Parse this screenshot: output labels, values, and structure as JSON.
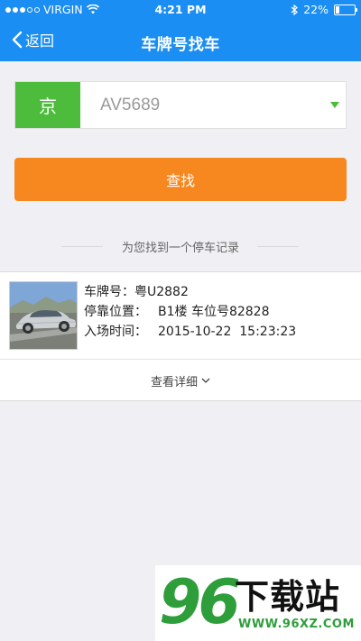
{
  "status_bar": {
    "carrier": "VIRGIN",
    "time": "4:21 PM",
    "battery": "22%",
    "signal_bars_full": 3,
    "signal_bars_total": 5
  },
  "nav": {
    "back_label": "返回",
    "title": "车牌号找车"
  },
  "plate_search": {
    "province": "京",
    "plate_value": "AV5689",
    "search_label": "查找"
  },
  "result": {
    "summary": "为您找到一个停车记录",
    "record": {
      "plate_label": "车牌号：",
      "plate_value": "粤U2882",
      "location_label": "停靠位置：",
      "location_value": "B1楼 车位号82828",
      "entry_label": "入场时间：",
      "entry_value": "2015-10-22  15:23:23"
    },
    "view_details_label": "查看详细"
  },
  "watermark": {
    "number": "96",
    "text": "下载站",
    "url": "WWW.96XZ.COM"
  },
  "icons": {
    "back": "chevron-left-icon",
    "dropdown": "triangle-down-icon",
    "expand": "chevron-down-icon",
    "wifi": "wifi-icon",
    "bluetooth": "bluetooth-icon",
    "battery": "battery-icon"
  },
  "colors": {
    "header": "#1a8ef2",
    "province": "#4dbc3c",
    "search_button": "#f7871f",
    "watermark_green": "#2e9e3a"
  }
}
